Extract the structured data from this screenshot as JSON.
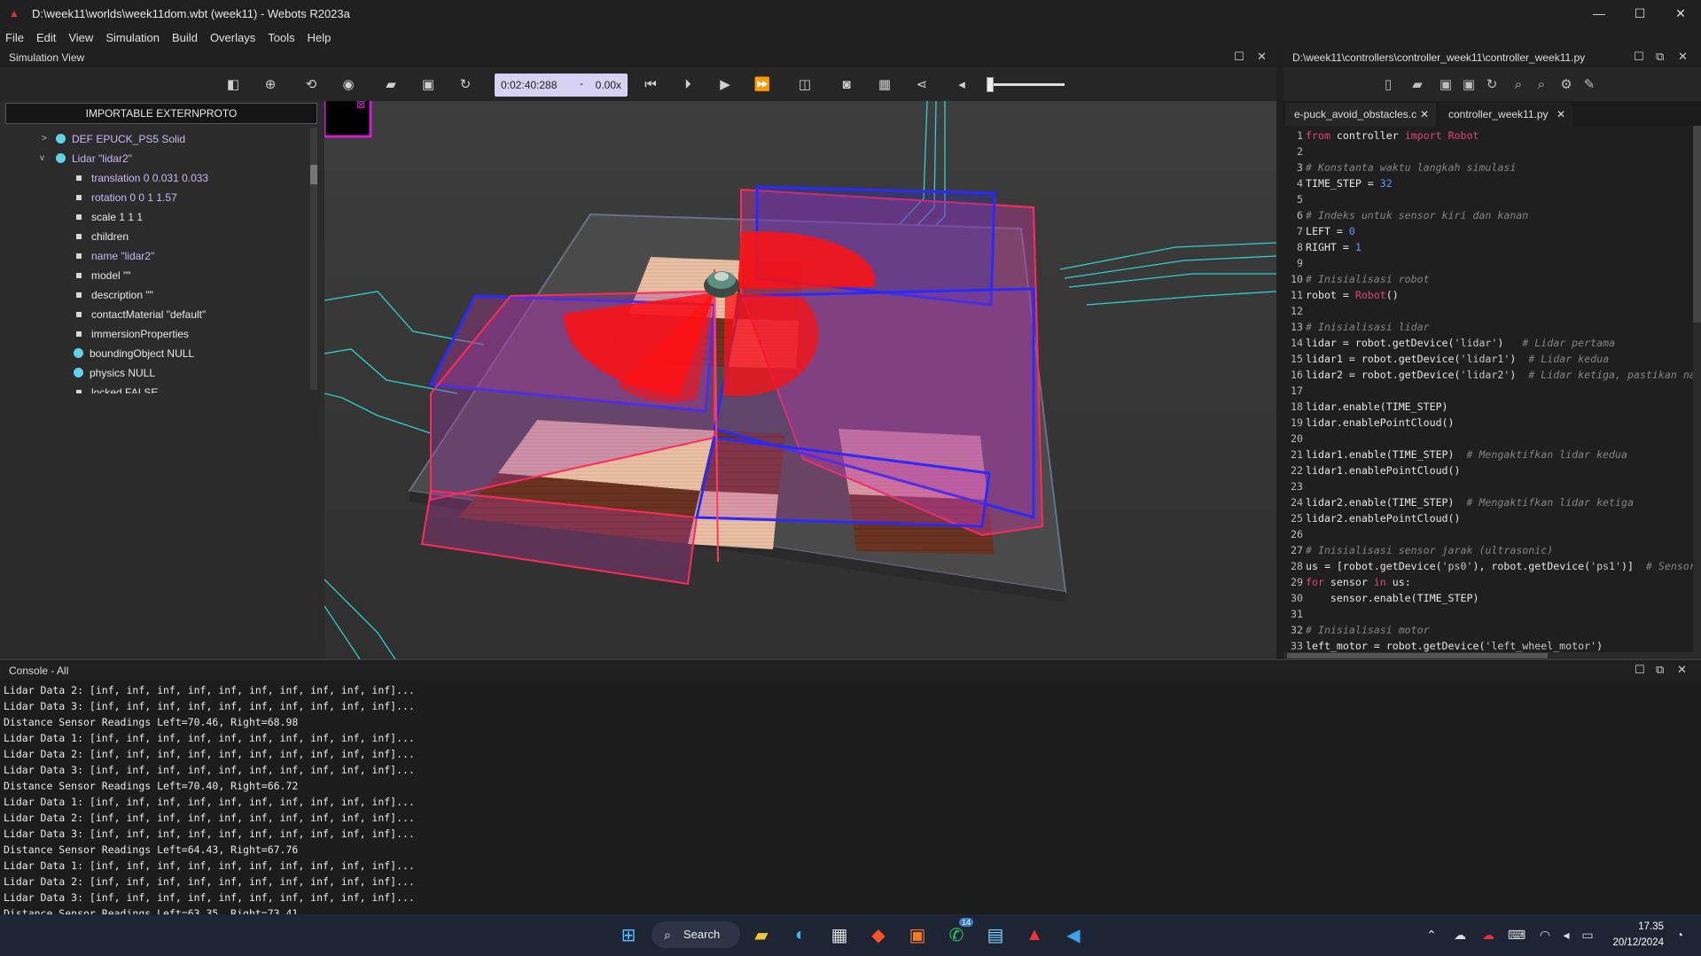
{
  "window": {
    "title": "D:\\week11\\worlds\\week11dom.wbt (week11) - Webots R2023a",
    "controls": [
      "—",
      "☐",
      "✕"
    ]
  },
  "menu": [
    "File",
    "Edit",
    "View",
    "Simulation",
    "Build",
    "Overlays",
    "Tools",
    "Help"
  ],
  "sim_view": {
    "label": "Simulation View",
    "time": "0:02:40:288",
    "time_sep": "-",
    "speed": "0.00x"
  },
  "scene_tree": {
    "header": "IMPORTABLE EXTERNPROTO",
    "rows": [
      {
        "text": "DEF EPUCK_PS5 Solid",
        "color": "#c9b8f5"
      },
      {
        "text": "Lidar \"lidar2\"",
        "color": "#c9b8f5"
      },
      {
        "text": "translation 0 0.031 0.033",
        "color": "#c9b8f5"
      },
      {
        "text": "rotation 0 0 1 1.57",
        "color": "#c9b8f5"
      },
      {
        "text": "scale 1 1 1",
        "color": "#e8e8e8"
      },
      {
        "text": "children",
        "color": "#e8e8e8"
      },
      {
        "text": "name \"lidar2\"",
        "color": "#c9b8f5"
      },
      {
        "text": "model \"\"",
        "color": "#e8e8e8"
      },
      {
        "text": "description \"\"",
        "color": "#e8e8e8"
      },
      {
        "text": "contactMaterial \"default\"",
        "color": "#e8e8e8"
      },
      {
        "text": "immersionProperties",
        "color": "#e8e8e8"
      },
      {
        "text": "boundingObject NULL",
        "color": "#e8e8e8"
      },
      {
        "text": "physics NULL",
        "color": "#e8e8e8"
      },
      {
        "text": "locked FALSE",
        "color": "#e8e8e8"
      }
    ]
  },
  "editor": {
    "path": "D:\\week11\\controllers\\controller_week11\\controller_week11.py",
    "tabs": [
      "e-puck_avoid_obstacles.c",
      "controller_week11.py"
    ],
    "active_tab": 1
  },
  "code_lines": [
    [
      [
        "kw",
        "from"
      ],
      [
        "tx",
        " controller "
      ],
      [
        "kw",
        "import"
      ],
      [
        "tx",
        " "
      ],
      [
        "cls",
        "Robot"
      ]
    ],
    [],
    [
      [
        "cm",
        "# Konstanta waktu langkah simulasi"
      ]
    ],
    [
      [
        "tx",
        "TIME_STEP = "
      ],
      [
        "nm",
        "32"
      ]
    ],
    [],
    [
      [
        "cm",
        "# Indeks untuk sensor kiri dan kanan"
      ]
    ],
    [
      [
        "tx",
        "LEFT = "
      ],
      [
        "nm",
        "0"
      ]
    ],
    [
      [
        "tx",
        "RIGHT = "
      ],
      [
        "nm",
        "1"
      ]
    ],
    [],
    [
      [
        "cm",
        "# Inisialisasi robot"
      ]
    ],
    [
      [
        "tx",
        "robot = "
      ],
      [
        "cls",
        "Robot"
      ],
      [
        "tx",
        "()"
      ]
    ],
    [],
    [
      [
        "cm",
        "# Inisialisasi lidar"
      ]
    ],
    [
      [
        "tx",
        "lidar = robot.getDevice("
      ],
      [
        "st",
        "'lidar'"
      ],
      [
        "tx",
        ")   "
      ],
      [
        "cm",
        "# Lidar pertama"
      ]
    ],
    [
      [
        "tx",
        "lidar1 = robot.getDevice("
      ],
      [
        "st",
        "'lidar1'"
      ],
      [
        "tx",
        ")  "
      ],
      [
        "cm",
        "# Lidar kedua"
      ]
    ],
    [
      [
        "tx",
        "lidar2 = robot.getDevice("
      ],
      [
        "st",
        "'lidar2'"
      ],
      [
        "tx",
        ")  "
      ],
      [
        "cm",
        "# Lidar ketiga, pastikan na"
      ]
    ],
    [],
    [
      [
        "tx",
        "lidar.enable(TIME_STEP)"
      ]
    ],
    [
      [
        "tx",
        "lidar.enablePointCloud()"
      ]
    ],
    [],
    [
      [
        "tx",
        "lidar1.enable(TIME_STEP)  "
      ],
      [
        "cm",
        "# Mengaktifkan lidar kedua"
      ]
    ],
    [
      [
        "tx",
        "lidar1.enablePointCloud()"
      ]
    ],
    [],
    [
      [
        "tx",
        "lidar2.enable(TIME_STEP)  "
      ],
      [
        "cm",
        "# Mengaktifkan lidar ketiga"
      ]
    ],
    [
      [
        "tx",
        "lidar2.enablePointCloud()"
      ]
    ],
    [],
    [
      [
        "cm",
        "# Inisialisasi sensor jarak (ultrasonic)"
      ]
    ],
    [
      [
        "tx",
        "us = [robot.getDevice("
      ],
      [
        "st",
        "'ps0'"
      ],
      [
        "tx",
        "), robot.getDevice("
      ],
      [
        "st",
        "'ps1'"
      ],
      [
        "tx",
        ")]  "
      ],
      [
        "cm",
        "# Sensor"
      ]
    ],
    [
      [
        "kw",
        "for"
      ],
      [
        "tx",
        " sensor "
      ],
      [
        "kw",
        "in"
      ],
      [
        "tx",
        " us:"
      ]
    ],
    [
      [
        "tx",
        "    sensor.enable(TIME_STEP)"
      ]
    ],
    [],
    [
      [
        "cm",
        "# Inisialisasi motor"
      ]
    ],
    [
      [
        "tx",
        "left_motor = robot.getDevice("
      ],
      [
        "st",
        "'left_wheel_motor'"
      ],
      [
        "tx",
        ")"
      ]
    ]
  ],
  "console": {
    "label": "Console - All",
    "lines": [
      "Lidar Data 2: [inf, inf, inf, inf, inf, inf, inf, inf, inf, inf]...",
      "Lidar Data 3: [inf, inf, inf, inf, inf, inf, inf, inf, inf, inf]...",
      "Distance Sensor Readings Left=70.46, Right=68.98",
      "Lidar Data 1: [inf, inf, inf, inf, inf, inf, inf, inf, inf, inf]...",
      "Lidar Data 2: [inf, inf, inf, inf, inf, inf, inf, inf, inf, inf]...",
      "Lidar Data 3: [inf, inf, inf, inf, inf, inf, inf, inf, inf, inf]...",
      "Distance Sensor Readings Left=70.40, Right=66.72",
      "Lidar Data 1: [inf, inf, inf, inf, inf, inf, inf, inf, inf, inf]...",
      "Lidar Data 2: [inf, inf, inf, inf, inf, inf, inf, inf, inf, inf]...",
      "Lidar Data 3: [inf, inf, inf, inf, inf, inf, inf, inf, inf, inf]...",
      "Distance Sensor Readings Left=64.43, Right=67.76",
      "Lidar Data 1: [inf, inf, inf, inf, inf, inf, inf, inf, inf, inf]...",
      "Lidar Data 2: [inf, inf, inf, inf, inf, inf, inf, inf, inf, inf]...",
      "Lidar Data 3: [inf, inf, inf, inf, inf, inf, inf, inf, inf, inf]...",
      "Distance Sensor Readings Left=63.35, Right=73.41"
    ]
  },
  "taskbar": {
    "search": "Search",
    "time": "17.35",
    "date": "20/12/2024",
    "whatsapp_badge": "14"
  },
  "colors": {
    "lidar_red": "#ff1010",
    "lidar_blue": "#2222ff",
    "accent": "#d7d1f3",
    "keyword": "#e0457b"
  }
}
